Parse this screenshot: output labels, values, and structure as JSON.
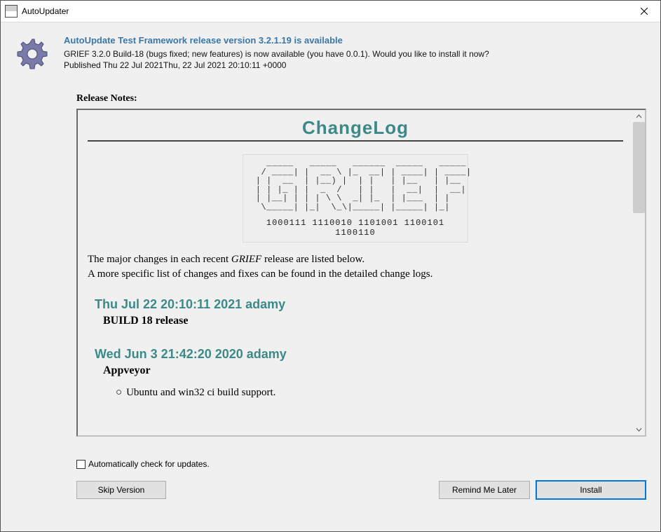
{
  "window": {
    "title": "AutoUpdater"
  },
  "header": {
    "headline": "AutoUpdate Test Framework release version 3.2.1.19 is available",
    "description": "GRIEF 3.2.0 Build-18 (bugs fixed; new features) is now available (you have 0.0.1). Would you like to install it now?",
    "published": "Published Thu 22 Jul 2021Thu, 22 Jul 2021 20:10:11 +0000"
  },
  "notes": {
    "label": "Release Notes:",
    "changelog_title": "ChangeLog",
    "ascii_art": "   _____   _____   ______  _____   _____\n  / ____| |  __ \\ |_  __| | ____| | ____|\n | |  __  | |__) |  | |   | |__   | |__\n | | |_ | |  _  /   | |   |  __|  |  __|\n | |__| | | | \\ \\  _| |_  | |___  | |\n  \\_____| |_|  \\_\\|_____| |_____| |_|",
    "ascii_binary": "1000111 1110010 1101001 1100101 1100110",
    "intro_1_pre": "The major changes in each recent ",
    "intro_1_em": "GRIEF",
    "intro_1_post": " release are listed below.",
    "intro_2": "A more specific list of changes and fixes can be found in the detailed change logs.",
    "entries": [
      {
        "date": "Thu Jul 22 20:10:11 2021 adamy",
        "subtitle": "BUILD 18 release",
        "items": []
      },
      {
        "date": "Wed Jun 3 21:42:20 2020 adamy",
        "subtitle": "Appveyor",
        "items": [
          "Ubuntu and win32 ci build support."
        ]
      }
    ]
  },
  "footer": {
    "auto_check_label": "Automatically check for updates.",
    "skip_label": "Skip Version",
    "later_label": "Remind Me Later",
    "install_label": "Install"
  }
}
